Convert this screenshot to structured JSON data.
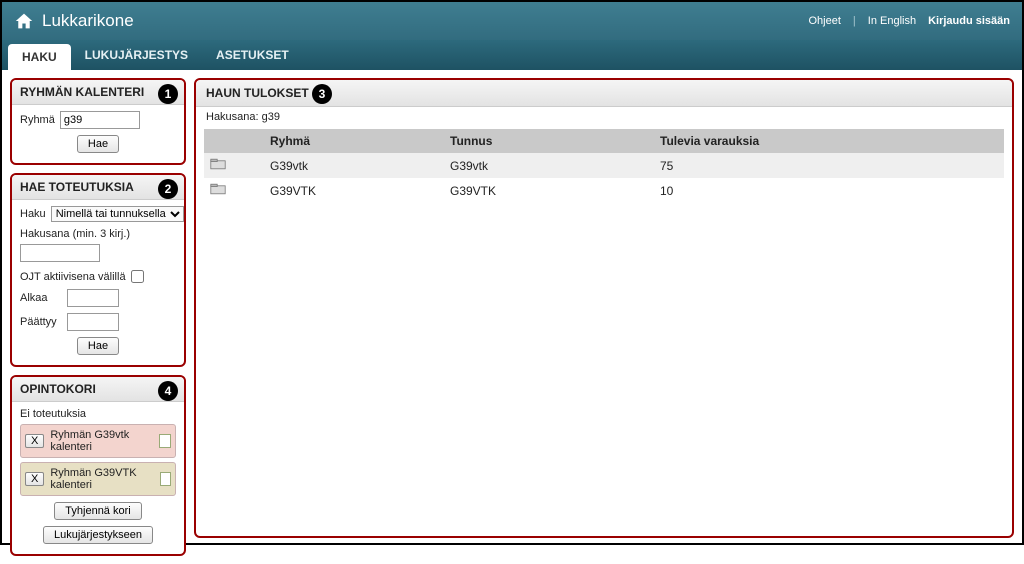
{
  "header": {
    "title": "Lukkarikone",
    "links": {
      "help": "Ohjeet",
      "lang": "In English",
      "login": "Kirjaudu sisään"
    }
  },
  "tabs": [
    {
      "label": "HAKU",
      "active": true
    },
    {
      "label": "LUKUJÄRJESTYS",
      "active": false
    },
    {
      "label": "ASETUKSET",
      "active": false
    }
  ],
  "sidebar": {
    "group_calendar": {
      "title": "RYHMÄN KALENTERI",
      "badge": "1",
      "label": "Ryhmä",
      "value": "g39",
      "search_btn": "Hae"
    },
    "search_impl": {
      "title": "HAE TOTEUTUKSIA",
      "badge": "2",
      "search_label": "Haku",
      "search_mode": "Nimellä tai tunnuksella",
      "keyword_label": "Hakusana (min. 3 kirj.)",
      "keyword_value": "",
      "ojt_label": "OJT aktiivisena välillä",
      "start_label": "Alkaa",
      "start_value": "",
      "end_label": "Päättyy",
      "end_value": "",
      "search_btn": "Hae"
    },
    "cart": {
      "title": "OPINTOKORI",
      "badge": "4",
      "empty": "Ei toteutuksia",
      "items": [
        {
          "label": "Ryhmän G39vtk kalenteri",
          "cls": "pink"
        },
        {
          "label": "Ryhmän G39VTK kalenteri",
          "cls": "tan"
        }
      ],
      "empty_btn": "Tyhjennä kori",
      "sched_btn": "Lukujärjestykseen"
    }
  },
  "results": {
    "title": "HAUN TULOKSET",
    "badge": "3",
    "keyword_prefix": "Hakusana: ",
    "keyword": "g39",
    "columns": [
      "",
      "Ryhmä",
      "Tunnus",
      "Tulevia varauksia"
    ],
    "rows": [
      {
        "ryhma": "G39vtk",
        "tunnus": "G39vtk",
        "varaukset": "75"
      },
      {
        "ryhma": "G39VTK",
        "tunnus": "G39VTK",
        "varaukset": "10"
      }
    ]
  }
}
